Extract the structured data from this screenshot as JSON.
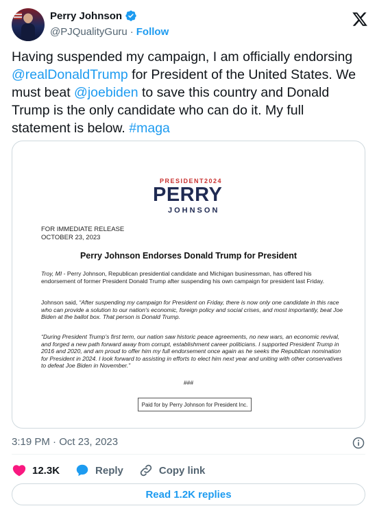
{
  "author": {
    "display_name": "Perry Johnson",
    "handle": "@PJQualityGuru",
    "separator": "·",
    "follow_label": "Follow",
    "verified": true
  },
  "tweet": {
    "text_parts": [
      {
        "type": "text",
        "value": "Having suspended my campaign, I am officially endorsing "
      },
      {
        "type": "mention",
        "value": "@realDonaldTrump"
      },
      {
        "type": "text",
        "value": " for President of the United States. We must beat "
      },
      {
        "type": "mention",
        "value": "@joebiden"
      },
      {
        "type": "text",
        "value": " to save this country and Donald Trump is the only candidate who can do it. My full statement is below. "
      },
      {
        "type": "mention",
        "value": "#maga"
      }
    ]
  },
  "document": {
    "logo_president": "PRESIDENT",
    "logo_year": "2024",
    "logo_perry": "PERRY",
    "logo_johnson": "JOHNSON",
    "release_line1": "FOR IMMEDIATE RELEASE",
    "release_line2": "OCTOBER 23, 2023",
    "title": "Perry Johnson Endorses Donald Trump for President",
    "p1_lead": "Troy, MI",
    "p1_body": " - Perry Johnson, Republican presidential candidate and Michigan businessman, has offered his endorsement of former President Donald Trump after suspending his own campaign for president last Friday.",
    "p2_lead": "Johnson said, ",
    "p2_quote": "“After suspending my campaign for President on Friday, there is now only one candidate in this race who can provide a solution to our nation's economic, foreign policy and social crises, and most importantly, beat Joe Biden at the ballot box. That person is Donald Trump.",
    "p3_quote": "“During President Trump's first term, our nation saw historic peace agreements, no new wars, an economic revival, and forged a new path forward away from corrupt, establishment career politicians. I supported President Trump in 2016 and 2020, and am proud to offer him my full endorsement once again as he seeks the Republican nomination for President in 2024. I look forward to assisting in efforts to elect him next year and uniting with other conservatives to defeat Joe Biden in November.”",
    "hashes": "###",
    "paid_for": "Paid for by Perry Johnson for President Inc."
  },
  "meta": {
    "time": "3:19 PM",
    "date_sep": "·",
    "date": "Oct 23, 2023"
  },
  "actions": {
    "likes": "12.3K",
    "reply_label": "Reply",
    "copy_link_label": "Copy link"
  },
  "replies_button": "Read 1.2K replies",
  "colors": {
    "accent": "#1d9bf0",
    "like": "#f91880",
    "muted": "#536471",
    "text": "#0f1419",
    "brand_navy": "#1f2a52",
    "brand_red": "#c8312f"
  },
  "icons": [
    "verified-badge-icon",
    "x-logo-icon",
    "info-icon",
    "heart-icon",
    "reply-bubble-icon",
    "link-icon"
  ]
}
